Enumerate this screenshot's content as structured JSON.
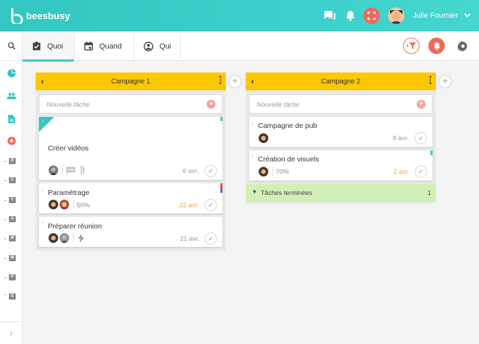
{
  "header": {
    "logo_text": "beesbusy",
    "user_name": "Julie Fournier",
    "icons": [
      "chat-icon",
      "bell-icon",
      "fullscreen-icon",
      "chevron-down-icon"
    ]
  },
  "sidebar": {
    "letters": [
      "R",
      "C",
      "C",
      "A",
      "W",
      "M",
      "P",
      "G"
    ],
    "icons": [
      "search-icon",
      "pie-chart-icon",
      "people-icon",
      "document-icon",
      "add-circle-icon",
      "chevron-right-icon"
    ]
  },
  "tabs": [
    {
      "label": "Quoi",
      "icon": "task-check-icon",
      "active": true
    },
    {
      "label": "Quand",
      "icon": "calendar-icon",
      "active": false
    },
    {
      "label": "Qui",
      "icon": "person-circle-icon",
      "active": false
    }
  ],
  "colors": {
    "accent": "#34c6c1",
    "column_header": "#fbc700",
    "red": "#ef6a5a",
    "done_green": "#d2f0b5",
    "orange_date": "#f1a43b"
  },
  "columns": [
    {
      "title": "Campagne 1",
      "new_task_placeholder": "Nouvelle tâche",
      "cards": [
        {
          "title": "Créer vidéos",
          "date": "6 avr."
        },
        {
          "title": "Paramétrage",
          "progress": "50%",
          "date": "22 avr."
        },
        {
          "title": "Préparer réunion",
          "date": "21 avr."
        }
      ]
    },
    {
      "title": "Campagne 2",
      "new_task_placeholder": "Nouvelle tâche",
      "cards": [
        {
          "title": "Campagne de pub",
          "date": "8 avr."
        },
        {
          "title": "Création de visuels",
          "progress": "70%",
          "date": "2 avr."
        }
      ],
      "done_label": "Tâches terminées",
      "done_count": "1"
    }
  ]
}
